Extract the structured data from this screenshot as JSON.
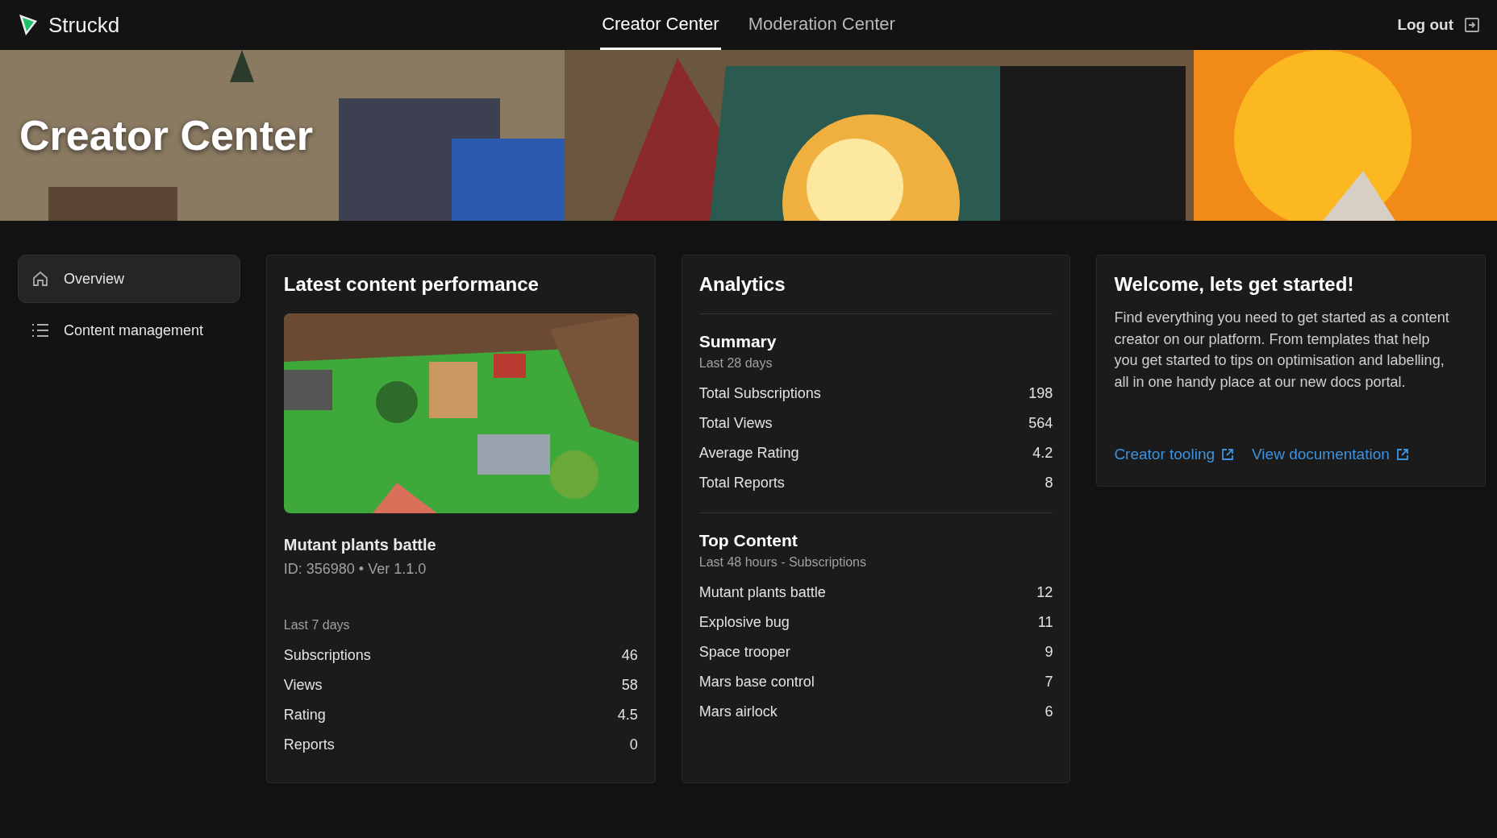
{
  "header": {
    "brand": "Struckd",
    "tabs": [
      {
        "label": "Creator Center",
        "selected": true
      },
      {
        "label": "Moderation Center",
        "selected": false
      }
    ],
    "logout": "Log out"
  },
  "banner": {
    "title": "Creator Center"
  },
  "sidebar": {
    "items": [
      {
        "label": "Overview",
        "kind": "home",
        "selected": true
      },
      {
        "label": "Content management",
        "kind": "list",
        "selected": false
      }
    ]
  },
  "latest": {
    "title": "Latest content performance",
    "name": "Mutant plants battle",
    "meta": "ID: 356980 • Ver 1.1.0",
    "period": "Last 7 days",
    "stats": [
      {
        "label": "Subscriptions",
        "value": "46"
      },
      {
        "label": "Views",
        "value": "58"
      },
      {
        "label": "Rating",
        "value": "4.5"
      },
      {
        "label": "Reports",
        "value": "0"
      }
    ]
  },
  "analytics": {
    "title": "Analytics",
    "sections": [
      {
        "title": "Summary",
        "period": "Last 28 days",
        "rows": [
          {
            "label": "Total Subscriptions",
            "value": "198"
          },
          {
            "label": "Total Views",
            "value": "564"
          },
          {
            "label": "Average Rating",
            "value": "4.2"
          },
          {
            "label": "Total Reports",
            "value": "8"
          }
        ]
      },
      {
        "title": "Top Content",
        "period": "Last 48 hours - Subscriptions",
        "rows": [
          {
            "label": "Mutant plants battle",
            "value": "12"
          },
          {
            "label": "Explosive bug",
            "value": "11"
          },
          {
            "label": "Space trooper",
            "value": "9"
          },
          {
            "label": "Mars base control",
            "value": "7"
          },
          {
            "label": "Mars airlock",
            "value": "6"
          }
        ]
      }
    ]
  },
  "welcome": {
    "title": "Welcome, lets get started!",
    "body": "Find everything you need to get started as a content creator on our platform. From templates that help you get started to tips on optimisation and labelling, all in one handy place at our new docs portal.",
    "links": [
      "Creator tooling",
      "View documentation"
    ]
  }
}
